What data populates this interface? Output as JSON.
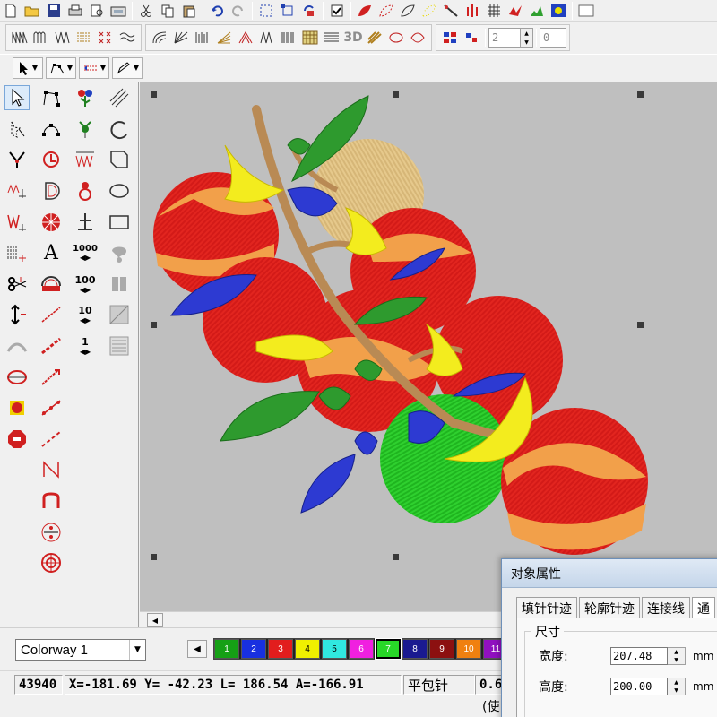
{
  "toolbar_top": {
    "icons": [
      "new-file-icon",
      "open-folder-icon",
      "save-icon",
      "print-icon",
      "print-preview-icon",
      "scanner-icon",
      "cut-icon",
      "copy-icon",
      "paste-icon",
      "undo-icon",
      "redo-icon",
      "select-region-icon",
      "select-node-icon",
      "rotate-icon",
      "checkbox-icon",
      "satin-leaf-icon",
      "fill-leaf-icon",
      "outline-leaf-icon",
      "dotted-leaf-icon",
      "needle-icon",
      "stitch-grid-icon",
      "grid-icon",
      "red-birds-icon",
      "green-plant-icon",
      "sequin-icon",
      "blank-frame-icon"
    ]
  },
  "toolbar_second": {
    "three_d_label": "3D",
    "spin_value": "2",
    "right_field_value": "0"
  },
  "canvas": {
    "background": "#c0c0c0"
  },
  "colorway": {
    "value": "Colorway 1"
  },
  "palette": [
    {
      "label": "1",
      "color": "#15a015"
    },
    {
      "label": "2",
      "color": "#1830e0"
    },
    {
      "label": "3",
      "color": "#e21d1d"
    },
    {
      "label": "4",
      "color": "#f0f000"
    },
    {
      "label": "5",
      "color": "#30e8e0"
    },
    {
      "label": "6",
      "color": "#f020e0"
    },
    {
      "label": "7",
      "color": "#28d828"
    },
    {
      "label": "8",
      "color": "#1a1a90"
    },
    {
      "label": "9",
      "color": "#8c1010"
    },
    {
      "label": "10",
      "color": "#f08010"
    },
    {
      "label": "11",
      "color": "#9010c0"
    }
  ],
  "status": {
    "stitch_count": "43940",
    "coords": "X=-181.69 Y= -42.23 L= 186.54 A=-166.91",
    "stitch_type": "平包针",
    "value_partial": "0.6",
    "hint": "(使"
  },
  "dialog": {
    "title": "对象属性",
    "tabs": [
      "填针针迹",
      "轮廓针迹",
      "连接线",
      "通"
    ],
    "group_label": "尺寸",
    "width_label": "宽度:",
    "width_value": "207.48",
    "height_label": "高度:",
    "height_value": "200.00",
    "unit": "mm"
  },
  "left_tools": [
    "select-arrow-icon",
    "node-edit-icon",
    "flower-stamp-icon",
    "parallel-lines-icon",
    "star-select-icon",
    "circle-nodes-icon",
    "carnation-icon",
    "arc-tool-icon",
    "scissor-y-icon",
    "rotate-red-icon",
    "red-zigzag-icon",
    "polygon-tool-icon",
    "red-zigzag-arrow-icon",
    "d-shape-icon",
    "sequence-icon",
    "ellipse-tool-icon",
    "red-w-icon",
    "grid-circle-icon",
    "anchor-icon",
    "rectangle-tool-icon",
    "zigzag-icon",
    "text-a-icon",
    "thousand-icon",
    "gray-paint-icon",
    "scissor-icon",
    "half-circle-icon",
    "hundred-icon",
    "gray-stack-icon",
    "updown-arrow-icon",
    "red-line-icon",
    "ten-icon",
    "gray-grid-icon",
    "gray-fan-icon",
    "red-chain-icon",
    "one-icon",
    "gray-list-icon",
    "hoop-icon",
    "red-arrow-icon",
    "stop-hand-icon",
    "red-dots-icon",
    "stop-sign-icon",
    "red-dots-2-icon",
    "n-path-icon",
    "s-curve-icon",
    "percent-icon",
    "target-icon"
  ],
  "left_text": {
    "thousand": "1000",
    "hundred": "100",
    "ten": "10",
    "one": "1",
    "text_a": "A"
  }
}
